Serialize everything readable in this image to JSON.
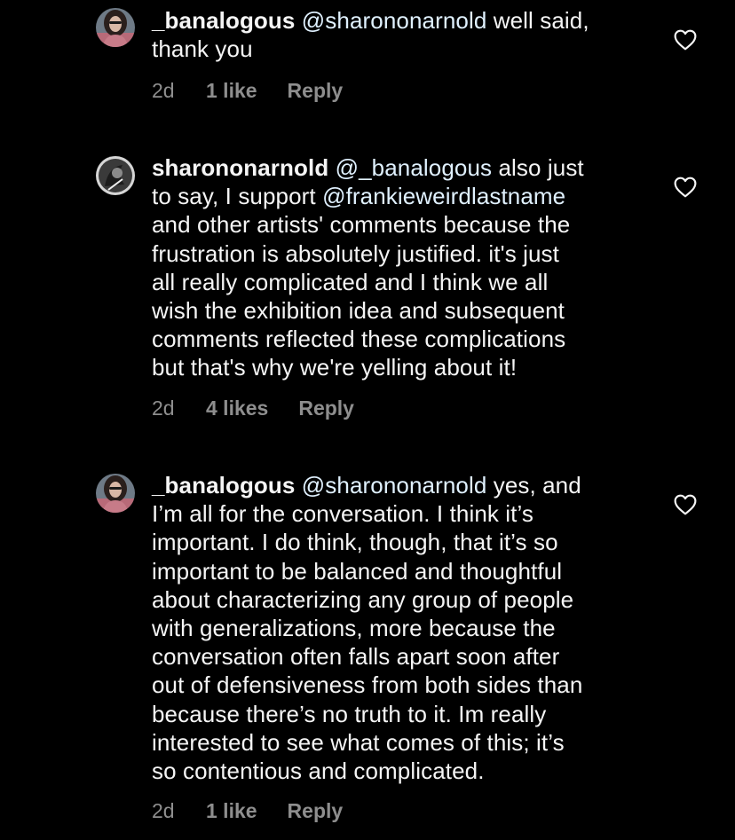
{
  "comments": [
    {
      "username": "_banalogous",
      "lines": [
        [
          {
            "t": "mention",
            "s": "@sharononarnold"
          },
          {
            "t": "text",
            "s": " well said,"
          }
        ],
        [
          {
            "t": "text",
            "s": "thank you"
          }
        ]
      ],
      "time": "2d",
      "likes": "1 like",
      "reply": "Reply"
    },
    {
      "username": "sharononarnold",
      "lines": [
        [
          {
            "t": "mention",
            "s": "@_banalogous"
          },
          {
            "t": "text",
            "s": " also just"
          }
        ],
        [
          {
            "t": "text",
            "s": "to say, I support "
          },
          {
            "t": "mention",
            "s": "@frankieweirdlastname"
          }
        ],
        [
          {
            "t": "text",
            "s": "and other artists' comments because the"
          }
        ],
        [
          {
            "t": "text",
            "s": "frustration is absolutely justified. it's just"
          }
        ],
        [
          {
            "t": "text",
            "s": "all really complicated and I think we all"
          }
        ],
        [
          {
            "t": "text",
            "s": "wish the exhibition idea and subsequent"
          }
        ],
        [
          {
            "t": "text",
            "s": "comments reflected these complications"
          }
        ],
        [
          {
            "t": "text",
            "s": "but that's why we're yelling about it!"
          }
        ]
      ],
      "time": "2d",
      "likes": "4 likes",
      "reply": "Reply"
    },
    {
      "username": "_banalogous",
      "lines": [
        [
          {
            "t": "mention",
            "s": "@sharononarnold"
          },
          {
            "t": "text",
            "s": " yes, and"
          }
        ],
        [
          {
            "t": "text",
            "s": "I’m all for the conversation. I think it’s"
          }
        ],
        [
          {
            "t": "text",
            "s": "important. I do think, though, that it’s so"
          }
        ],
        [
          {
            "t": "text",
            "s": "important to be balanced and thoughtful"
          }
        ],
        [
          {
            "t": "text",
            "s": "about characterizing any group of people"
          }
        ],
        [
          {
            "t": "text",
            "s": "with generalizations, more because the"
          }
        ],
        [
          {
            "t": "text",
            "s": "conversation often falls apart soon after"
          }
        ],
        [
          {
            "t": "text",
            "s": "out of defensiveness from both sides than"
          }
        ],
        [
          {
            "t": "text",
            "s": "because there’s no truth to it. Im really"
          }
        ],
        [
          {
            "t": "text",
            "s": "interested to see what comes of this; it’s"
          }
        ],
        [
          {
            "t": "text",
            "s": "so contentious and complicated."
          }
        ]
      ],
      "time": "2d",
      "likes": "1 like",
      "reply": "Reply"
    }
  ],
  "icons": {
    "like": "heart-outline-icon",
    "avatar_1": "profile-photo",
    "avatar_2": "profile-photo",
    "avatar_3": "profile-photo"
  },
  "colors": {
    "background": "#000000",
    "text": "#f5f5f5",
    "mention": "#e0f1ff",
    "meta": "#8e8e8e"
  }
}
